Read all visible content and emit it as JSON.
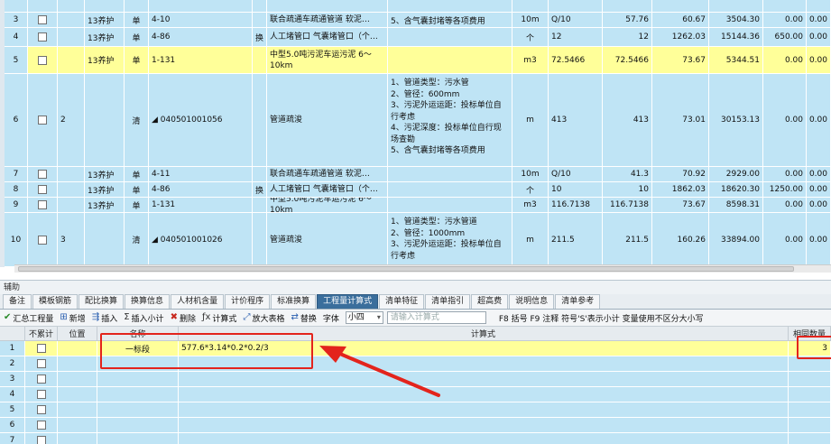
{
  "top_rows": [
    {
      "n": "3",
      "type": "13养护",
      "kind": "单",
      "code": "4-10",
      "huan": "",
      "name": "联合疏通车疏通管道 软泥…",
      "desc": "5、含气囊封堵等各项费用",
      "unit": "10m",
      "qty_expr": "Q/10",
      "qty": "57.76",
      "price": "60.67",
      "total": "3504.30",
      "a": "0.00",
      "b": "0.00"
    },
    {
      "n": "4",
      "type": "13养护",
      "kind": "单",
      "code": "4-86",
      "huan": "换",
      "name": "人工堵管口 气囊堵管口（个…",
      "desc": "",
      "unit": "个",
      "qty_expr": "12",
      "qty": "12",
      "price": "1262.03",
      "total": "15144.36",
      "a": "650.00",
      "b": "0.00"
    },
    {
      "n": "5",
      "type": "13养护",
      "kind": "单",
      "code": "1-131",
      "huan": "",
      "name": "中型5.0吨污泥车运污泥 6～10km",
      "desc": "",
      "unit": "m3",
      "qty_expr": "72.5466",
      "qty": "72.5466",
      "price": "73.67",
      "total": "5344.51",
      "a": "0.00",
      "b": "0.00"
    },
    {
      "n": "6",
      "seq": "2",
      "type": "",
      "kind": "清",
      "code": "◢ 040501001056",
      "huan": "",
      "name": "管道疏浚",
      "desc": "1、管道类型：污水管\n2、管径：600mm\n3、污泥外运运距：投标单位自行考虑\n4、污泥深度：投标单位自行现场查勘\n5、含气囊封堵等各项费用",
      "unit": "m",
      "qty_expr": "413",
      "qty": "413",
      "price": "73.01",
      "total": "30153.13",
      "a": "0.00",
      "b": "0.00"
    },
    {
      "n": "7",
      "type": "13养护",
      "kind": "单",
      "code": "4-11",
      "huan": "",
      "name": "联合疏通车疏通管道 软泥…",
      "desc": "",
      "unit": "10m",
      "qty_expr": "Q/10",
      "qty": "41.3",
      "price": "70.92",
      "total": "2929.00",
      "a": "0.00",
      "b": "0.00"
    },
    {
      "n": "8",
      "type": "13养护",
      "kind": "单",
      "code": "4-86",
      "huan": "换",
      "name": "人工堵管口 气囊堵管口（个…",
      "desc": "",
      "unit": "个",
      "qty_expr": "10",
      "qty": "10",
      "price": "1862.03",
      "total": "18620.30",
      "a": "1250.00",
      "b": "0.00"
    },
    {
      "n": "9",
      "type": "13养护",
      "kind": "单",
      "code": "1-131",
      "huan": "",
      "name": "中型5.0吨污泥车运污泥 6～10km",
      "desc": "",
      "unit": "m3",
      "qty_expr": "116.7138",
      "qty": "116.7138",
      "price": "73.67",
      "total": "8598.31",
      "a": "0.00",
      "b": "0.00"
    },
    {
      "n": "10",
      "seq": "3",
      "type": "",
      "kind": "清",
      "code": "◢ 040501001026",
      "huan": "",
      "name": "管道疏浚",
      "desc": "1、管道类型：污水管道\n2、管径：1000mm\n3、污泥外运运距：投标单位自行考虑",
      "unit": "m",
      "qty_expr": "211.5",
      "qty": "211.5",
      "price": "160.26",
      "total": "33894.00",
      "a": "0.00",
      "b": "0.00"
    }
  ],
  "aux_title": "辅助",
  "tabs": [
    "备注",
    "模板钢筋",
    "配比换算",
    "换算信息",
    "人材机含量",
    "计价程序",
    "标准换算",
    "工程量计算式",
    "清单特征",
    "清单指引",
    "超高费",
    "说明信息",
    "清单参考"
  ],
  "active_tab": 7,
  "toolbar": {
    "summary": "汇总工程量",
    "add": "新增",
    "insert": "插入",
    "insert_subtotal": "插入小计",
    "delete": "删除",
    "calc": "计算式",
    "zoom_table": "放大表格",
    "replace": "替换",
    "font_label": "字体",
    "font_value": "小四",
    "formula_placeholder": "请输入计算式",
    "hint": "F8 括号 F9 注释 符号'S'表示小计 变量使用不区分大小写"
  },
  "bottom_headers": {
    "nosum": "不累计",
    "pos": "位置",
    "name": "名称",
    "formula": "计算式",
    "same": "相同数量"
  },
  "bottom_rows": [
    {
      "n": "1",
      "name": "一标段",
      "formula": "577.6*3.14*0.2*0.2/3",
      "same": "3"
    },
    {
      "n": "2",
      "name": "",
      "formula": "",
      "same": ""
    },
    {
      "n": "3",
      "name": "",
      "formula": "",
      "same": ""
    },
    {
      "n": "4",
      "name": "",
      "formula": "",
      "same": ""
    },
    {
      "n": "5",
      "name": "",
      "formula": "",
      "same": ""
    },
    {
      "n": "6",
      "name": "",
      "formula": "",
      "same": ""
    },
    {
      "n": "7",
      "name": "",
      "formula": "",
      "same": ""
    }
  ],
  "colors": {
    "row_bg": "#bfe4f5",
    "selected": "#ffff99",
    "active_tab": "#3a6e9c",
    "annotation": "#e3241c"
  }
}
